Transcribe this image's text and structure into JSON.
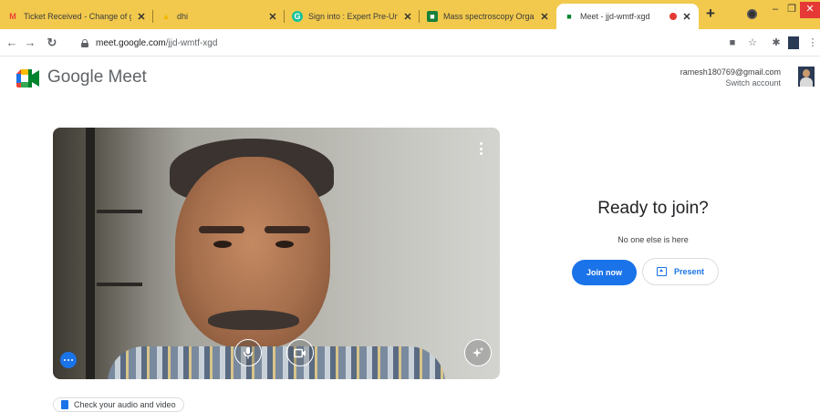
{
  "browser": {
    "tabs": [
      {
        "title": "Ticket Received - Change of gr",
        "icon": "gmail-icon",
        "color": "#EA4335"
      },
      {
        "title": "dhi",
        "icon": "drive-icon",
        "color": "#F4B400"
      },
      {
        "title": "Sign into : Expert Pre-Universi",
        "icon": "grammarly-icon",
        "color": "#15C39A"
      },
      {
        "title": "Mass spectroscopy Organic ch",
        "icon": "classroom-icon",
        "color": "#188038"
      },
      {
        "title": "Meet - jjd-wmtf-xgd",
        "icon": "meet-icon",
        "color": "#00832D",
        "active": true
      }
    ],
    "url_host": "meet.google.com",
    "url_path": "/jjd-wmtf-xgd"
  },
  "header": {
    "brand": "Google Meet",
    "account_email": "ramesh180769@gmail.com",
    "switch_account": "Switch account"
  },
  "join": {
    "title": "Ready to join?",
    "subtitle": "No one else is here",
    "join_label": "Join now",
    "present_label": "Present"
  },
  "check_av": "Check your audio and video",
  "colors": {
    "tabbar": "#F2C94C",
    "accent": "#1A73E8",
    "record": "#E53935"
  }
}
